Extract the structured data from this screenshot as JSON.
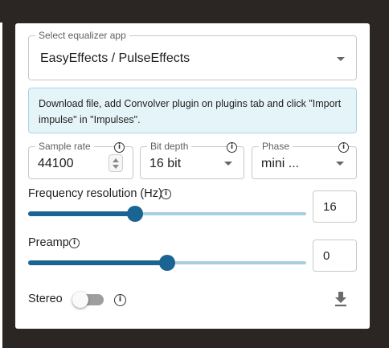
{
  "equalizer_app": {
    "label": "Select equalizer app",
    "value": "EasyEffects / PulseEffects"
  },
  "alert": {
    "text": "Download file, add Convolver plugin on plugins tab and click \"Import impulse\" in \"Impulses\"."
  },
  "sample_rate": {
    "label": "Sample rate",
    "value": "44100"
  },
  "bit_depth": {
    "label": "Bit depth",
    "value": "16 bit"
  },
  "phase": {
    "label": "Phase",
    "value": "mini  ..."
  },
  "frequency_resolution": {
    "label": "Frequency resolution (Hz)",
    "value": "16",
    "slider_fraction": 0.38
  },
  "preamp": {
    "label": "Preamp",
    "value": "0",
    "slider_fraction": 0.5
  },
  "stereo": {
    "label": "Stereo",
    "enabled": false
  },
  "icons": {
    "info": "info-icon",
    "dropdown": "caret-down-icon",
    "download": "download-icon"
  },
  "colors": {
    "accent": "#1a6493",
    "track": "#a8cfe0",
    "alert_bg": "#e5f4f9",
    "page_bg": "#2b2523"
  }
}
